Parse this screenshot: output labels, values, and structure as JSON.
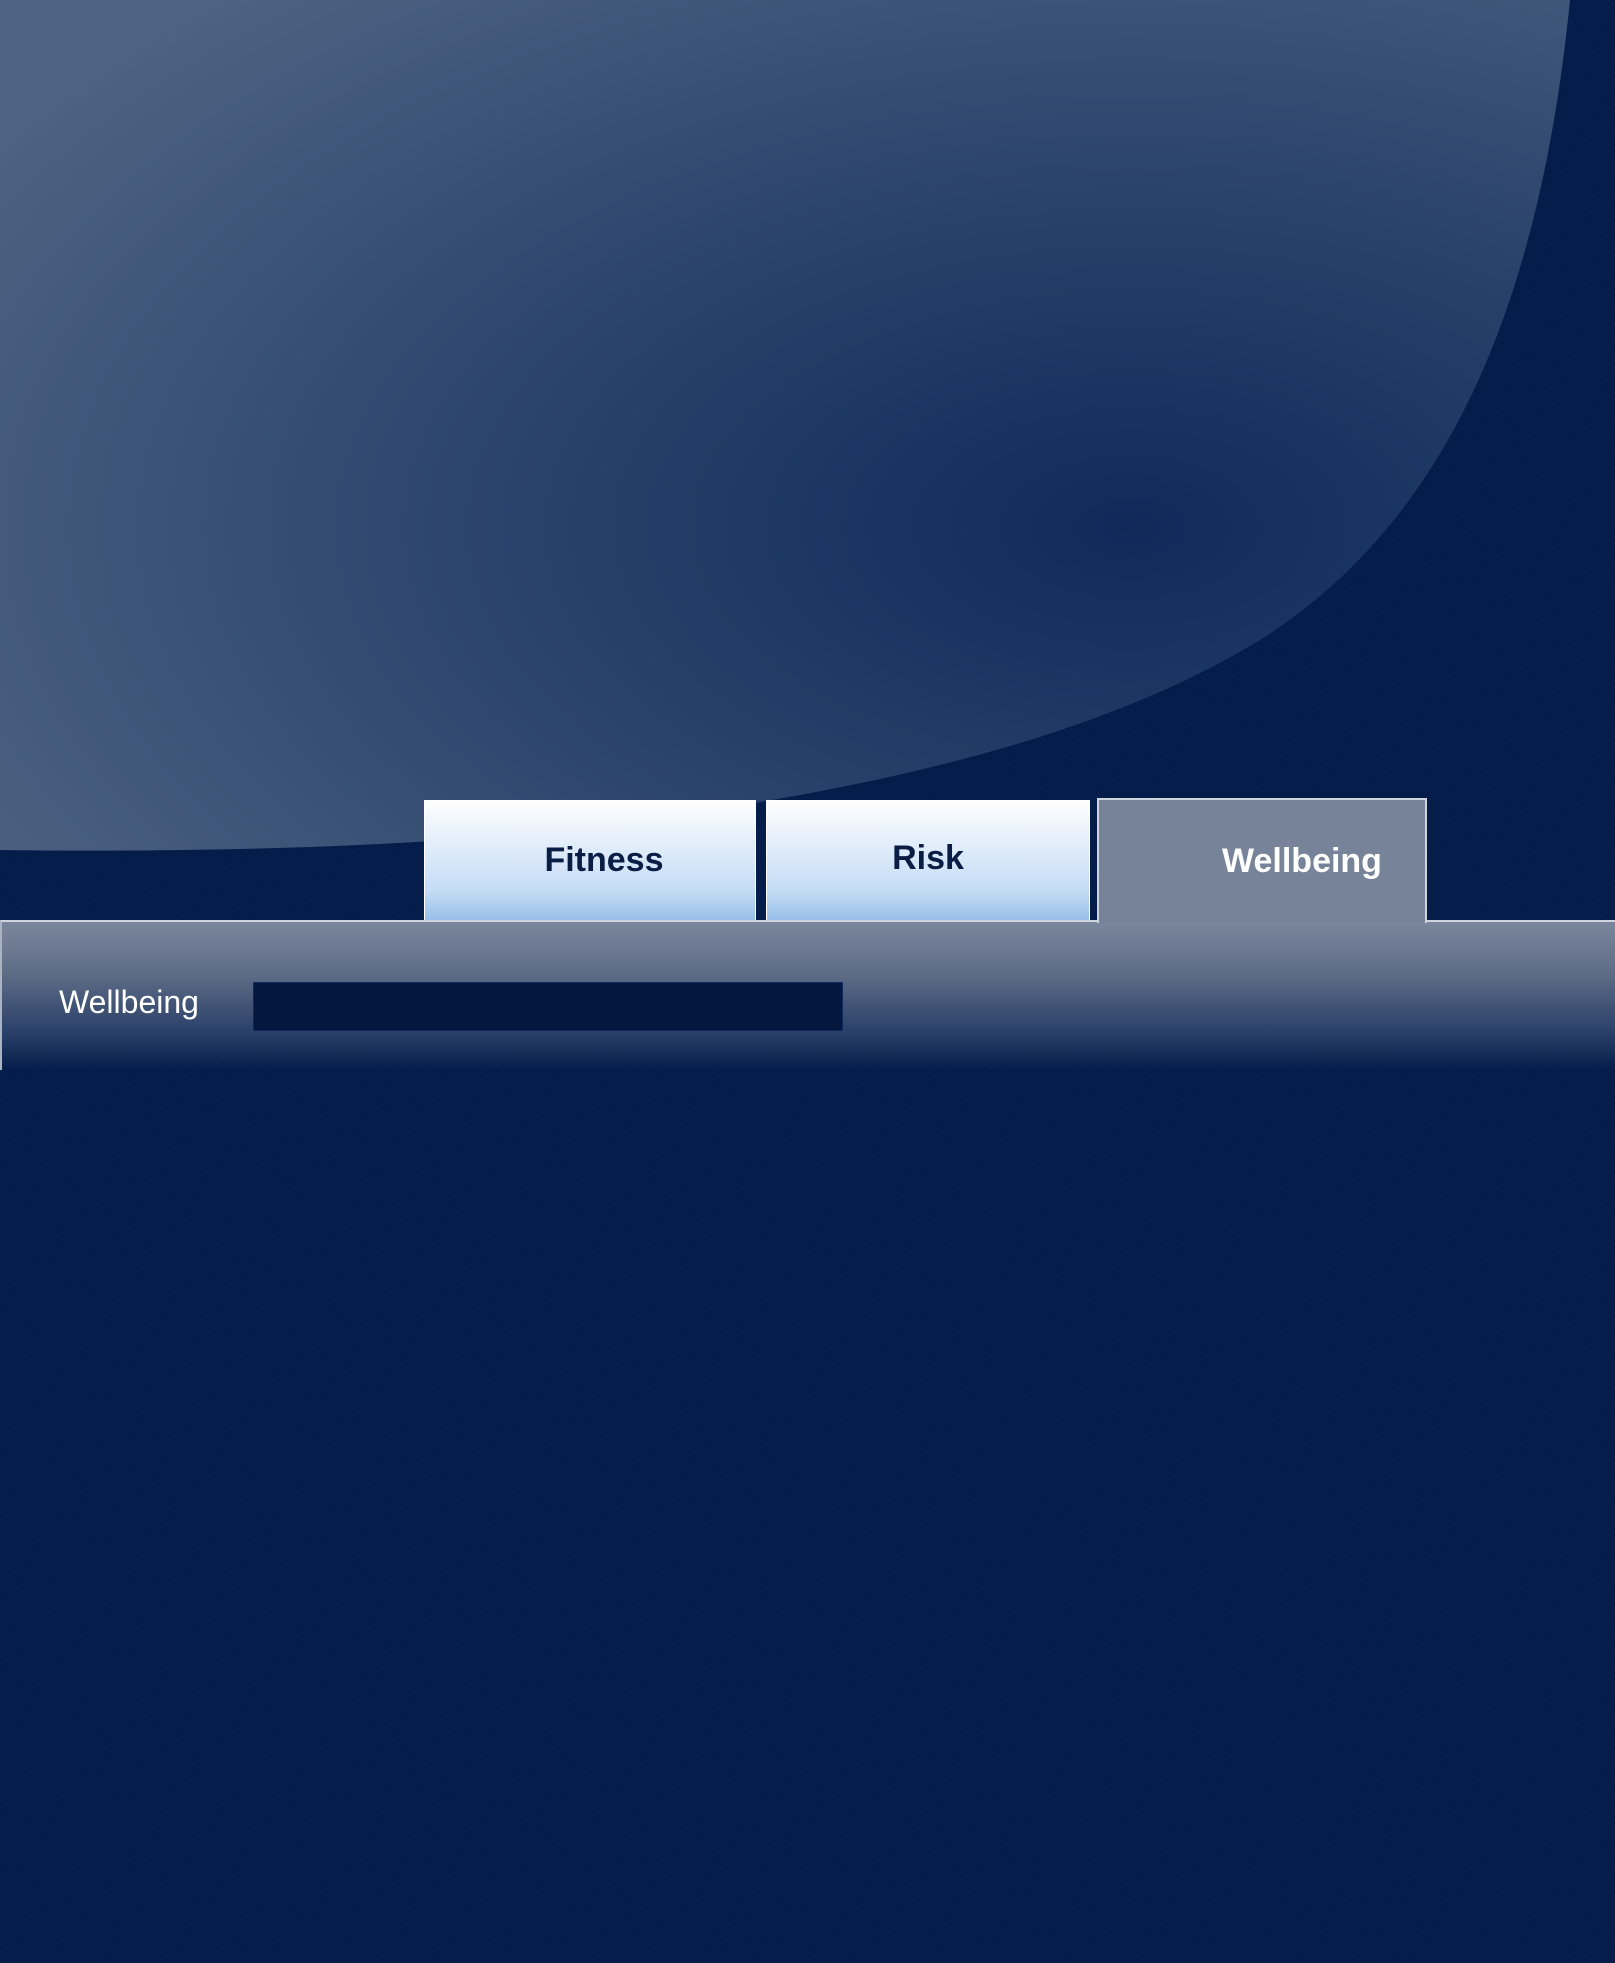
{
  "tabs": {
    "fitness": {
      "label": "Fitness",
      "active": false
    },
    "risk": {
      "label": "Risk",
      "active": false
    },
    "wellbeing": {
      "label": "Wellbeing",
      "active": true
    }
  },
  "panel": {
    "wellbeing_label": "Wellbeing",
    "wellbeing_level": 0
  },
  "colors": {
    "background": "#041c4a",
    "active_tab": "#778398",
    "inactive_tab_top": "#ffffff",
    "inactive_tab_bottom": "#97bfe9",
    "bar_track": "#03173f"
  }
}
